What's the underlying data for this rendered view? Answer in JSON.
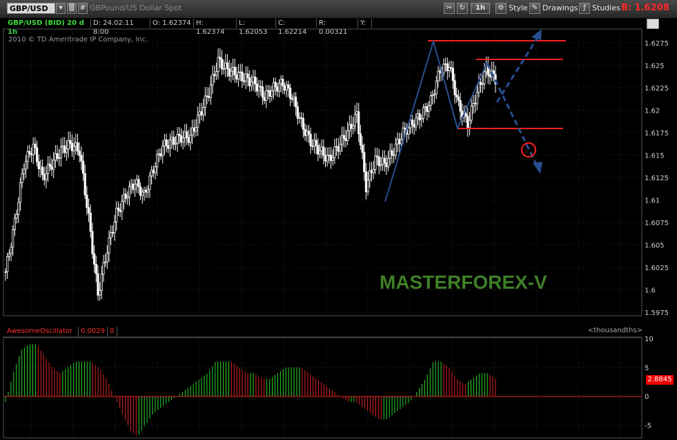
{
  "toolbar": {
    "symbol": "GBP/USD",
    "description": "GBPound/US Dollar Spot",
    "timeframe": "1h",
    "style_label": "Style",
    "drawings_label": "Drawings",
    "studies_label": "Studies",
    "bid": "B: 1.6208"
  },
  "info_bar": {
    "symbol_info": "GBP/USD (BID) 20 d 1h",
    "date": "D: 24.02.11 8:00",
    "open": "O: 1.62374",
    "high": "H: 1.62374",
    "low": "L: 1.62053",
    "close": "C: 1.62214",
    "range": "R: 0.00321",
    "y": "Y:"
  },
  "copyright": "2010 © TD Ameritrade IP Company, Inc.",
  "watermark": "MASTERFOREX-V",
  "price_axis": [
    "1.6275",
    "1.625",
    "1.6225",
    "1.62",
    "1.6175",
    "1.615",
    "1.6125",
    "1.61",
    "1.6075",
    "1.605",
    "1.6025",
    "1.6",
    "1.5975"
  ],
  "indicator": {
    "name": "AwesomeOscillator",
    "value1": "0.0029",
    "value2": "0",
    "units": "<thousandths>",
    "current": "2.8845",
    "axis": [
      "10",
      "5",
      "0",
      "-5"
    ]
  },
  "colors": {
    "candle_up": "#ffffff",
    "candle_down": "#ffffff",
    "osc_up": "#2bd62b",
    "osc_down": "#e02020",
    "drawing_blue": "#2a4f8f",
    "level_red": "#ff2020",
    "trendline": "#000000"
  },
  "chart_data": {
    "type": "candlestick",
    "price_ylim": [
      1.5975,
      1.6275
    ],
    "close_path": [
      [
        0,
        1.602
      ],
      [
        5,
        1.6075
      ],
      [
        10,
        1.614
      ],
      [
        15,
        1.616
      ],
      [
        20,
        1.6125
      ],
      [
        25,
        1.614
      ],
      [
        30,
        1.6155
      ],
      [
        35,
        1.6162
      ],
      [
        40,
        1.6155
      ],
      [
        45,
        1.608
      ],
      [
        50,
        1.5995
      ],
      [
        55,
        1.6045
      ],
      [
        60,
        1.6085
      ],
      [
        65,
        1.6105
      ],
      [
        70,
        1.612
      ],
      [
        75,
        1.6105
      ],
      [
        80,
        1.6135
      ],
      [
        85,
        1.616
      ],
      [
        90,
        1.6165
      ],
      [
        95,
        1.617
      ],
      [
        100,
        1.617
      ],
      [
        105,
        1.6195
      ],
      [
        110,
        1.622
      ],
      [
        115,
        1.6255
      ],
      [
        120,
        1.6245
      ],
      [
        125,
        1.624
      ],
      [
        130,
        1.6235
      ],
      [
        135,
        1.623
      ],
      [
        140,
        1.6215
      ],
      [
        145,
        1.6225
      ],
      [
        150,
        1.623
      ],
      [
        155,
        1.6215
      ],
      [
        160,
        1.6185
      ],
      [
        165,
        1.6165
      ],
      [
        170,
        1.6155
      ],
      [
        175,
        1.6145
      ],
      [
        180,
        1.616
      ],
      [
        185,
        1.6175
      ],
      [
        190,
        1.6195
      ],
      [
        195,
        1.6115
      ],
      [
        200,
        1.6145
      ],
      [
        205,
        1.614
      ],
      [
        210,
        1.6155
      ],
      [
        215,
        1.6175
      ],
      [
        220,
        1.6185
      ],
      [
        225,
        1.6195
      ],
      [
        230,
        1.621
      ],
      [
        235,
        1.6245
      ],
      [
        240,
        1.625
      ],
      [
        245,
        1.6205
      ],
      [
        250,
        1.6185
      ],
      [
        255,
        1.622
      ],
      [
        260,
        1.6245
      ],
      [
        265,
        1.6235
      ]
    ],
    "ao_values": [
      -1,
      4,
      8,
      9,
      9,
      7,
      5,
      4,
      5,
      6,
      6,
      6,
      5,
      3,
      0,
      -3,
      -6,
      -7,
      -5,
      -3,
      -2,
      -1,
      0,
      1,
      2,
      3,
      4,
      6,
      6,
      6,
      5,
      4,
      4,
      3,
      3,
      4,
      5,
      5,
      5,
      4,
      3,
      2,
      1,
      0,
      -1,
      -1,
      -2,
      -3,
      -4,
      -4,
      -3,
      -2,
      -1,
      1,
      3,
      6,
      6,
      5,
      3,
      2,
      3,
      4,
      4,
      3
    ],
    "ao_ylim": [
      -7,
      10
    ]
  }
}
